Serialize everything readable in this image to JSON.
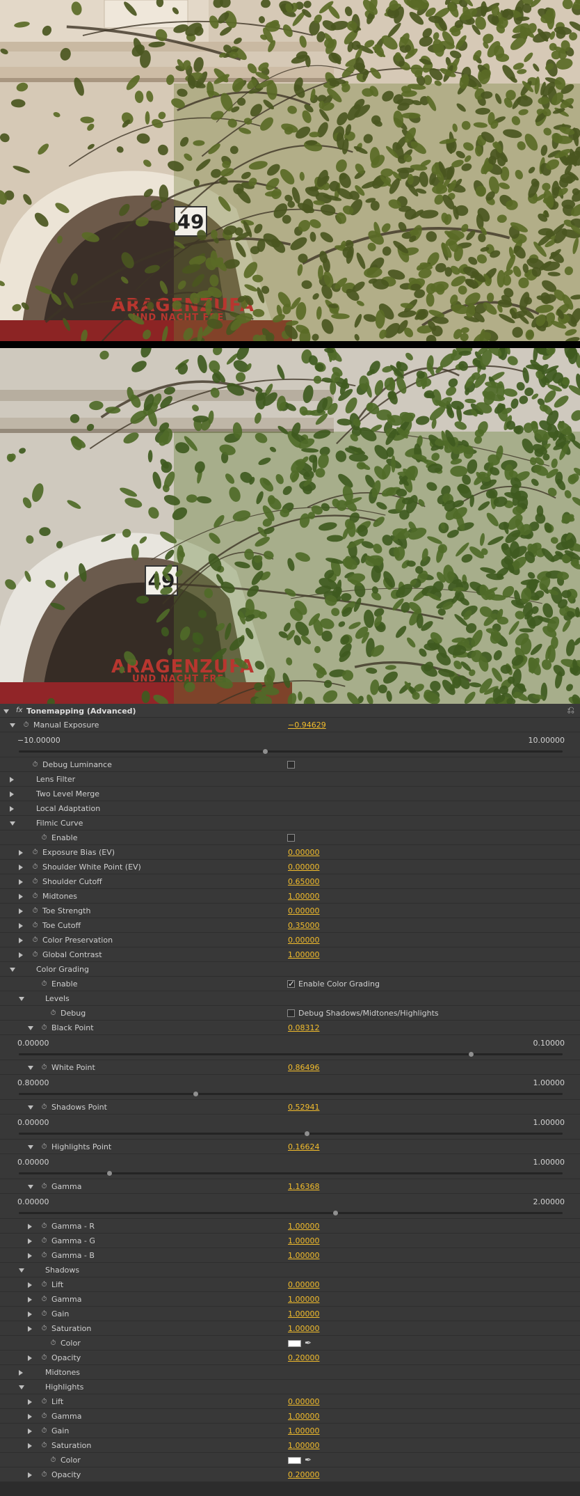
{
  "panel": {
    "effect_title": "Tonemapping (Advanced)",
    "fx_icon": "fx-icon",
    "reset_icon": "reset-icon",
    "rows": [
      {
        "type": "param",
        "indent": 1,
        "twirl": "open",
        "stopwatch": true,
        "label": "Manual Exposure",
        "value": "−0.94629"
      },
      {
        "type": "slider",
        "min": "−10.00000",
        "max": "10.00000",
        "fraction": 0.4527
      },
      {
        "type": "check",
        "indent": 2,
        "twirl": "none",
        "stopwatch": true,
        "label": "Debug Luminance",
        "checked": false,
        "check_label": ""
      },
      {
        "type": "group",
        "indent": 1,
        "twirl": "closed",
        "label": "Lens Filter"
      },
      {
        "type": "group",
        "indent": 1,
        "twirl": "closed",
        "label": "Two Level Merge"
      },
      {
        "type": "group",
        "indent": 1,
        "twirl": "closed",
        "label": "Local Adaptation"
      },
      {
        "type": "group",
        "indent": 1,
        "twirl": "open",
        "label": "Filmic Curve"
      },
      {
        "type": "check",
        "indent": 3,
        "twirl": "none",
        "stopwatch": true,
        "label": "Enable",
        "checked": false,
        "check_label": ""
      },
      {
        "type": "param",
        "indent": 2,
        "twirl": "closed",
        "stopwatch": true,
        "label": "Exposure Bias (EV)",
        "value": "0.00000"
      },
      {
        "type": "param",
        "indent": 2,
        "twirl": "closed",
        "stopwatch": true,
        "label": "Shoulder White Point (EV)",
        "value": "0.00000"
      },
      {
        "type": "param",
        "indent": 2,
        "twirl": "closed",
        "stopwatch": true,
        "label": "Shoulder Cutoff",
        "value": "0.65000"
      },
      {
        "type": "param",
        "indent": 2,
        "twirl": "closed",
        "stopwatch": true,
        "label": "Midtones",
        "value": "1.00000"
      },
      {
        "type": "param",
        "indent": 2,
        "twirl": "closed",
        "stopwatch": true,
        "label": "Toe Strength",
        "value": "0.00000"
      },
      {
        "type": "param",
        "indent": 2,
        "twirl": "closed",
        "stopwatch": true,
        "label": "Toe Cutoff",
        "value": "0.35000"
      },
      {
        "type": "param",
        "indent": 2,
        "twirl": "closed",
        "stopwatch": true,
        "label": "Color Preservation",
        "value": "0.00000"
      },
      {
        "type": "param",
        "indent": 2,
        "twirl": "closed",
        "stopwatch": true,
        "label": "Global Contrast",
        "value": "1.00000"
      },
      {
        "type": "group",
        "indent": 1,
        "twirl": "open",
        "label": "Color Grading"
      },
      {
        "type": "check",
        "indent": 3,
        "twirl": "none",
        "stopwatch": true,
        "label": "Enable",
        "checked": true,
        "check_label": "Enable Color Grading"
      },
      {
        "type": "group",
        "indent": 2,
        "twirl": "open",
        "label": "Levels"
      },
      {
        "type": "check",
        "indent": 4,
        "twirl": "none",
        "stopwatch": true,
        "label": "Debug",
        "checked": false,
        "check_label": "Debug Shadows/Midtones/Highlights"
      },
      {
        "type": "param",
        "indent": 3,
        "twirl": "open",
        "stopwatch": true,
        "label": "Black Point",
        "value": "0.08312"
      },
      {
        "type": "slider",
        "min": "0.00000",
        "max": "0.10000",
        "fraction": 0.8312
      },
      {
        "type": "param",
        "indent": 3,
        "twirl": "open",
        "stopwatch": true,
        "label": "White Point",
        "value": "0.86496"
      },
      {
        "type": "slider",
        "min": "0.80000",
        "max": "1.00000",
        "fraction": 0.3248
      },
      {
        "type": "param",
        "indent": 3,
        "twirl": "open",
        "stopwatch": true,
        "label": "Shadows Point",
        "value": "0.52941"
      },
      {
        "type": "slider",
        "min": "0.00000",
        "max": "1.00000",
        "fraction": 0.52941
      },
      {
        "type": "param",
        "indent": 3,
        "twirl": "open",
        "stopwatch": true,
        "label": "Highlights Point",
        "value": "0.16624"
      },
      {
        "type": "slider",
        "min": "0.00000",
        "max": "1.00000",
        "fraction": 0.16624
      },
      {
        "type": "param",
        "indent": 3,
        "twirl": "open",
        "stopwatch": true,
        "label": "Gamma",
        "value": "1.16368"
      },
      {
        "type": "slider",
        "min": "0.00000",
        "max": "2.00000",
        "fraction": 0.58184
      },
      {
        "type": "param",
        "indent": 3,
        "twirl": "closed",
        "stopwatch": true,
        "label": "Gamma - R",
        "value": "1.00000"
      },
      {
        "type": "param",
        "indent": 3,
        "twirl": "closed",
        "stopwatch": true,
        "label": "Gamma - G",
        "value": "1.00000"
      },
      {
        "type": "param",
        "indent": 3,
        "twirl": "closed",
        "stopwatch": true,
        "label": "Gamma - B",
        "value": "1.00000"
      },
      {
        "type": "group",
        "indent": 2,
        "twirl": "open",
        "label": "Shadows"
      },
      {
        "type": "param",
        "indent": 3,
        "twirl": "closed",
        "stopwatch": true,
        "label": "Lift",
        "value": "0.00000"
      },
      {
        "type": "param",
        "indent": 3,
        "twirl": "closed",
        "stopwatch": true,
        "label": "Gamma",
        "value": "1.00000"
      },
      {
        "type": "param",
        "indent": 3,
        "twirl": "closed",
        "stopwatch": true,
        "label": "Gain",
        "value": "1.00000"
      },
      {
        "type": "param",
        "indent": 3,
        "twirl": "closed",
        "stopwatch": true,
        "label": "Saturation",
        "value": "1.00000"
      },
      {
        "type": "color",
        "indent": 4,
        "twirl": "none",
        "stopwatch": true,
        "label": "Color",
        "color": "#ffffff"
      },
      {
        "type": "param",
        "indent": 3,
        "twirl": "closed",
        "stopwatch": true,
        "label": "Opacity",
        "value": "0.20000"
      },
      {
        "type": "group",
        "indent": 2,
        "twirl": "closed",
        "label": "Midtones"
      },
      {
        "type": "group",
        "indent": 2,
        "twirl": "open",
        "label": "Highlights"
      },
      {
        "type": "param",
        "indent": 3,
        "twirl": "closed",
        "stopwatch": true,
        "label": "Lift",
        "value": "0.00000"
      },
      {
        "type": "param",
        "indent": 3,
        "twirl": "closed",
        "stopwatch": true,
        "label": "Gamma",
        "value": "1.00000"
      },
      {
        "type": "param",
        "indent": 3,
        "twirl": "closed",
        "stopwatch": true,
        "label": "Gain",
        "value": "1.00000"
      },
      {
        "type": "param",
        "indent": 3,
        "twirl": "closed",
        "stopwatch": true,
        "label": "Saturation",
        "value": "1.00000"
      },
      {
        "type": "color",
        "indent": 4,
        "twirl": "none",
        "stopwatch": true,
        "label": "Color",
        "color": "#ffffff"
      },
      {
        "type": "param",
        "indent": 3,
        "twirl": "closed",
        "stopwatch": true,
        "label": "Opacity",
        "value": "0.20000"
      }
    ]
  },
  "preview_top": {
    "plate_text": "49",
    "sign_line1": "ARAGENZUFA",
    "sign_line2": "UND NACHT FRE",
    "colors": {
      "wall": "#d9cdbd",
      "leaf": "#5a6a26",
      "sign_bg": "#7a1a1a"
    }
  },
  "preview_bottom": {
    "plate_text": "49",
    "sign_line1": "ARAGENZUFA",
    "sign_line2": "UND NACHT FRE",
    "colors": {
      "wall": "#d6d3cc",
      "leaf": "#4f6a28",
      "sign_bg": "#8a1f22"
    }
  },
  "accent_color": "#f3bd2c"
}
